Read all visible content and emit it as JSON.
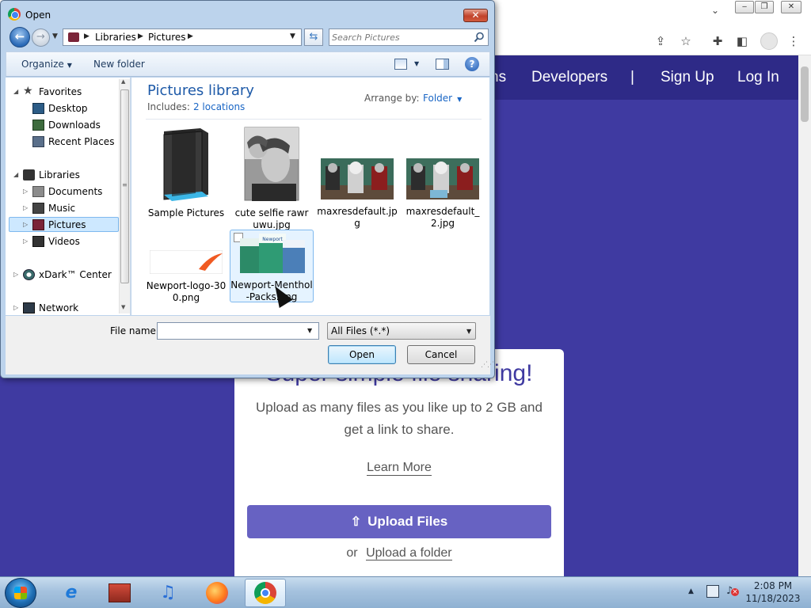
{
  "browser": {
    "nav_links": [
      "ns",
      "Developers",
      "|",
      "Sign Up",
      "Log In"
    ],
    "hero": {
      "title": "Super simple file sharing!",
      "subtitle": "Upload as many files as you like up to 2 GB and get a link to share.",
      "learn_more": "Learn More",
      "upload_button": "Upload Files",
      "or": "or",
      "upload_folder": "Upload a folder"
    },
    "colors": {
      "site_bg": "#3f3aa1",
      "nav_bg": "#2e2a87",
      "button": "#6762c2"
    }
  },
  "dialog": {
    "title": "Open",
    "breadcrumb": [
      "Libraries",
      "Pictures"
    ],
    "search_placeholder": "Search Pictures",
    "organize": "Organize",
    "new_folder": "New folder",
    "nav_tree": {
      "favorites": "Favorites",
      "desktop": "Desktop",
      "downloads": "Downloads",
      "recent_places": "Recent Places",
      "libraries": "Libraries",
      "documents": "Documents",
      "music": "Music",
      "pictures": "Pictures",
      "videos": "Videos",
      "xdark": "xDark™ Center",
      "network": "Network"
    },
    "library_title": "Pictures library",
    "includes_label": "Includes:",
    "includes_link": "2 locations",
    "arrange_by_label": "Arrange by:",
    "arrange_by_value": "Folder",
    "files": [
      "Sample Pictures",
      "cute selfie rawr uwu.jpg",
      "maxresdefault.jpg",
      "maxresdefault_2.jpg",
      "Newport-logo-300.png",
      "Newport-Menthol-Packs.png"
    ],
    "newport_brand": "Newport",
    "file_name_label": "File name:",
    "file_name_value": "",
    "file_type_filter": "All Files (*.*)",
    "open_button": "Open",
    "cancel_button": "Cancel"
  },
  "taskbar": {
    "time": "2:08 PM",
    "date": "11/18/2023"
  }
}
